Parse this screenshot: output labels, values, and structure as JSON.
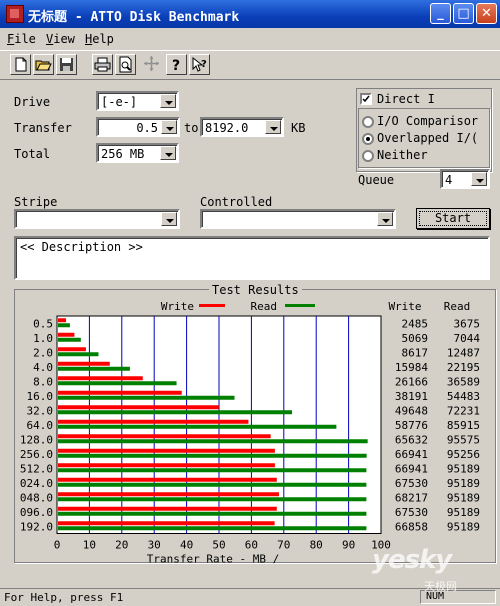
{
  "window": {
    "title": "无标题 - ATTO Disk Benchmark",
    "minimize": "_",
    "maximize": "□",
    "close": "✕"
  },
  "menu": {
    "items": [
      {
        "label": "File",
        "key": "F",
        "rest": "ile"
      },
      {
        "label": "View",
        "key": "V",
        "rest": "iew"
      },
      {
        "label": "Help",
        "key": "H",
        "rest": "elp"
      }
    ]
  },
  "toolbar": {
    "buttons": [
      "new-file-icon",
      "open-folder-icon",
      "save-disk-icon",
      "print-icon",
      "print-preview-icon",
      "move-cross-icon",
      "help-question-icon",
      "context-help-icon"
    ]
  },
  "settings": {
    "drive_label": "Drive",
    "drive_value": "[-e-]",
    "transfer_label": "Transfer",
    "transfer_from": "0.5",
    "transfer_to_label": "to",
    "transfer_to": "8192.0",
    "transfer_unit": "KB",
    "total_label": "Total",
    "total_value": "256 MB",
    "stripe_label": "Stripe",
    "stripe_value": "",
    "controlled_label": "Controlled",
    "controlled_value": "",
    "direct_io_label": "Direct I",
    "direct_io_checked": true,
    "io_options": [
      {
        "label": "I/O Comparisor",
        "selected": false
      },
      {
        "label": "Overlapped I/(",
        "selected": true
      },
      {
        "label": "Neither",
        "selected": false
      }
    ],
    "queue_label": "Queue",
    "queue_value": "4",
    "start_label": "Start",
    "description": "<< Description >>"
  },
  "results": {
    "title": "Test Results",
    "legend_write": "Write",
    "legend_read": "Read",
    "col_write": "Write",
    "col_read": "Read",
    "write_color": "#ff0000",
    "read_color": "#008000"
  },
  "chart_data": {
    "type": "bar",
    "orientation": "horizontal",
    "xlabel": "Transfer Rate - MB /",
    "xlim": [
      0,
      100
    ],
    "xticks": [
      0,
      10,
      20,
      30,
      40,
      50,
      60,
      70,
      80,
      90,
      100
    ],
    "categories": [
      "0.5",
      "1.0",
      "2.0",
      "4.0",
      "8.0",
      "16.0",
      "32.0",
      "64.0",
      "128.0",
      "256.0",
      "512.0",
      "024.0",
      "048.0",
      "096.0",
      "192.0"
    ],
    "series": [
      {
        "name": "Write",
        "values": [
          2.485,
          5.069,
          8.617,
          15.984,
          26.166,
          38.191,
          49.648,
          58.776,
          65.632,
          66.941,
          66.941,
          67.53,
          68.217,
          67.53,
          66.858
        ],
        "labels": [
          "2485",
          "5069",
          "8617",
          "15984",
          "26166",
          "38191",
          "49648",
          "58776",
          "65632",
          "66941",
          "66941",
          "67530",
          "68217",
          "67530",
          "66858"
        ]
      },
      {
        "name": "Read",
        "values": [
          3.675,
          7.044,
          12.487,
          22.195,
          36.589,
          54.483,
          72.231,
          85.915,
          95.575,
          95.256,
          95.189,
          95.189,
          95.189,
          95.189,
          95.189
        ],
        "labels": [
          "3675",
          "7044",
          "12487",
          "22195",
          "36589",
          "54483",
          "72231",
          "85915",
          "95575",
          "95256",
          "95189",
          "95189",
          "95189",
          "95189",
          "95189"
        ]
      }
    ]
  },
  "status": {
    "text": "For Help, press F1",
    "num": "NUM"
  },
  "watermark": {
    "logo": "yesky",
    "sub": "天极网"
  }
}
